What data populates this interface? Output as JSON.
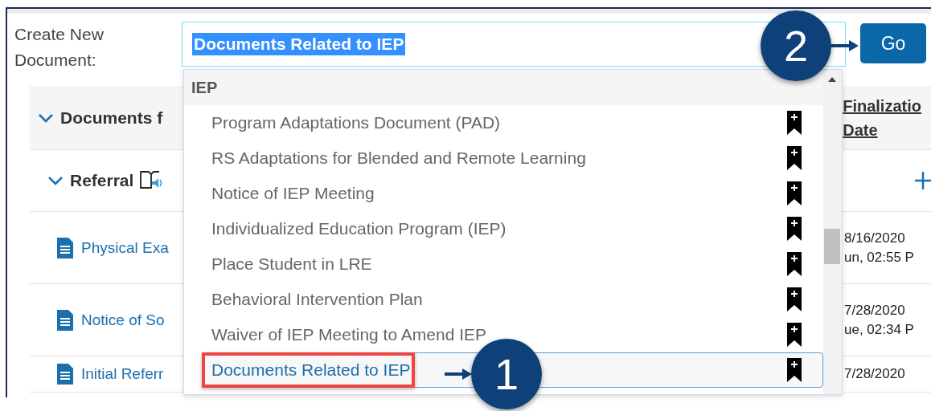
{
  "create_label": "Create New Document:",
  "document_field": {
    "value": "Documents Related to IEP",
    "text_selected": true
  },
  "go_button": "Go",
  "dropdown": {
    "group": "IEP",
    "items": [
      {
        "label": "Program Adaptations Document (PAD)",
        "selected": false
      },
      {
        "label": "RS Adaptations for Blended and Remote Learning",
        "selected": false
      },
      {
        "label": "Notice of IEP Meeting",
        "selected": false
      },
      {
        "label": "Individualized Education Program (IEP)",
        "selected": false
      },
      {
        "label": "Place Student in LRE",
        "selected": false
      },
      {
        "label": "Behavioral Intervention Plan",
        "selected": false
      },
      {
        "label": "Waiver of IEP Meeting to Amend IEP",
        "selected": false
      },
      {
        "label": "Documents Related to IEP",
        "selected": true
      }
    ]
  },
  "section": {
    "title": "Documents f",
    "expanded": true
  },
  "subsection": {
    "title": "Referral",
    "expanded": true
  },
  "date_header": [
    "Finalizatio",
    "Date"
  ],
  "documents": [
    {
      "name": "Physical Exa",
      "date": "8/16/2020",
      "time": "un, 02:55 P"
    },
    {
      "name": "Notice of So",
      "date": "7/28/2020",
      "time": "ue, 02:34 P"
    },
    {
      "name": "Initial Referr",
      "date": "7/28/2020"
    }
  ],
  "callouts": [
    {
      "number": "1"
    },
    {
      "number": "2"
    }
  ]
}
